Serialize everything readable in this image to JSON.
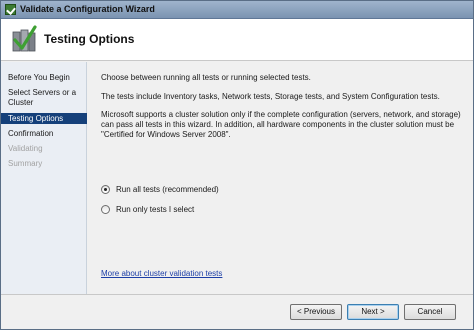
{
  "window": {
    "title": "Validate a Configuration Wizard"
  },
  "header": {
    "title": "Testing Options"
  },
  "nav": {
    "steps": [
      {
        "label": "Before You Begin",
        "state": "normal"
      },
      {
        "label": "Select Servers or a Cluster",
        "state": "normal"
      },
      {
        "label": "Testing Options",
        "state": "active"
      },
      {
        "label": "Confirmation",
        "state": "normal"
      },
      {
        "label": "Validating",
        "state": "disabled"
      },
      {
        "label": "Summary",
        "state": "disabled"
      }
    ]
  },
  "content": {
    "intro": "Choose between running all tests or running selected tests.",
    "tests_description": "The tests include Inventory tasks, Network tests, Storage tests, and System Configuration tests.",
    "support_note": "Microsoft supports a cluster solution only if the complete configuration (servers, network, and storage) can pass all tests in this wizard. In addition, all hardware components in the cluster solution must be \"Certified for Windows Server 2008\".",
    "options": [
      {
        "label": "Run all tests (recommended)",
        "checked": true
      },
      {
        "label": "Run only tests I select",
        "checked": false
      }
    ],
    "more_link": "More about cluster validation tests"
  },
  "footer": {
    "previous_label": "< Previous",
    "next_label": "Next >",
    "cancel_label": "Cancel"
  },
  "colors": {
    "nav_active_bg": "#15407a",
    "link": "#1c3ea6",
    "disabled_text": "#a2a2a2"
  }
}
